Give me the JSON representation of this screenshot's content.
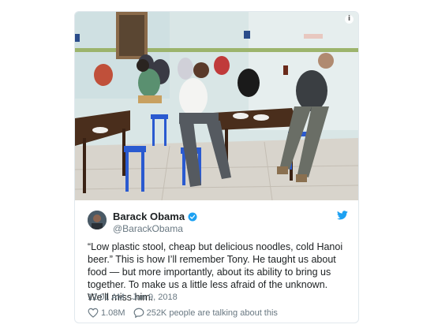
{
  "tweet": {
    "author_name": "Barack Obama",
    "author_handle": "@BarackObama",
    "text": "“Low plastic stool, cheap but delicious noodles, cold Hanoi beer.” This is how I’ll remember Tony. He taught us about food — but more importantly, about its ability to bring us together. To make us a little less afraid of the unknown. We’ll miss him.",
    "timestamp": "12:01 AM - Jun 9, 2018",
    "likes": "1.08M",
    "talking": "252K people are talking about this",
    "info_glyph": "i"
  },
  "icons": {
    "info": "info-icon",
    "verified": "verified-badge-icon",
    "twitter": "twitter-bird-icon",
    "like": "heart-icon",
    "reply": "speech-bubble-icon"
  },
  "colors": {
    "twitter_blue": "#1da1f2",
    "text_primary": "#1c2022",
    "text_secondary": "#697882",
    "border": "#e1e8ed"
  }
}
